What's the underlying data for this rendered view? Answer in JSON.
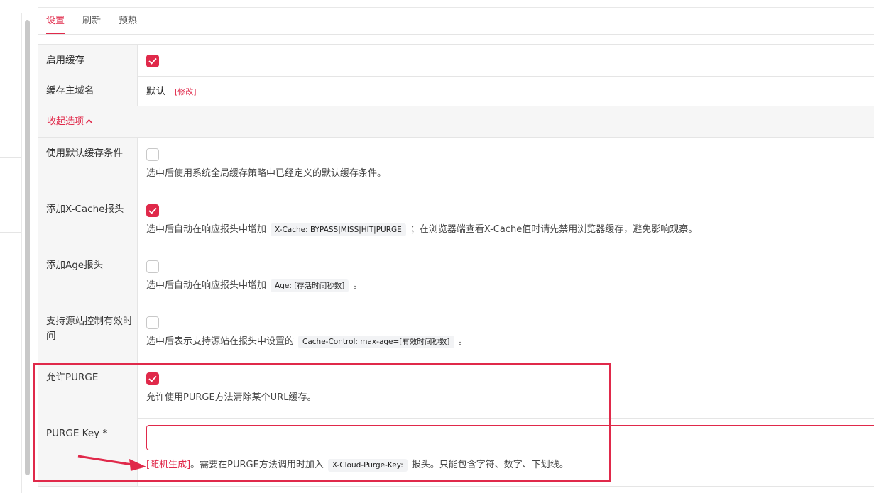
{
  "tabs": [
    {
      "label": "设置",
      "active": true
    },
    {
      "label": "刷新",
      "active": false
    },
    {
      "label": "预热",
      "active": false
    }
  ],
  "rows": {
    "enable_cache": {
      "label": "启用缓存",
      "checked": true
    },
    "cache_host": {
      "label": "缓存主域名",
      "value": "默认",
      "edit": "[修改]"
    },
    "collapse": {
      "label": "收起选项"
    },
    "default_conditions": {
      "label": "使用默认缓存条件",
      "checked": false,
      "desc": "选中后使用系统全局缓存策略中已经定义的默认缓存条件。"
    },
    "x_cache": {
      "label": "添加X-Cache报头",
      "checked": true,
      "desc_before": "选中后自动在响应报头中增加",
      "code": "X-Cache: BYPASS|MISS|HIT|PURGE",
      "desc_after": "；在浏览器端查看X-Cache值时请先禁用浏览器缓存，避免影响观察。"
    },
    "age": {
      "label": "添加Age报头",
      "checked": false,
      "desc_before": "选中后自动在响应报头中增加",
      "code": "Age: [存活时间秒数]",
      "desc_after": "。"
    },
    "origin_control": {
      "label": "支持源站控制有效时间",
      "checked": false,
      "desc_before": "选中后表示支持源站在报头中设置的",
      "code": "Cache-Control: max-age=[有效时间秒数]",
      "desc_after": "。"
    },
    "purge": {
      "label": "允许PURGE",
      "checked": true,
      "desc": "允许使用PURGE方法清除某个URL缓存。"
    },
    "purge_key": {
      "label": "PURGE Key *",
      "value": "",
      "random_link": "[随机生成]",
      "desc_before": "。需要在PURGE方法调用时加入",
      "code": "X-Cloud-Purge-Key:",
      "desc_after": "报头。只能包含字符、数字、下划线。"
    }
  },
  "colors": {
    "accent": "#e0294a",
    "label_bg": "#f6f6f6",
    "border": "#e5e5e5",
    "code_bg": "#f2f3f5"
  }
}
